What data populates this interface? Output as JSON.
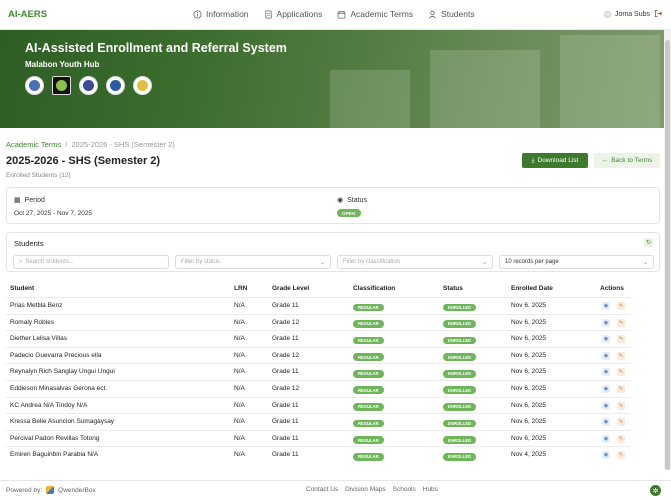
{
  "app": {
    "brand": "AI-AERS"
  },
  "nav": {
    "items": [
      {
        "label": "Information",
        "icon": "info-icon"
      },
      {
        "label": "Applications",
        "icon": "document-icon"
      },
      {
        "label": "Academic Terms",
        "icon": "calendar-icon"
      },
      {
        "label": "Students",
        "icon": "user-icon"
      }
    ],
    "user_name": "Joma Subs"
  },
  "hero": {
    "title": "AI-Assisted Enrollment and Referral System",
    "subtitle": "Malabon Youth Hub"
  },
  "breadcrumb": {
    "parent": "Academic Terms",
    "separator": "/",
    "current": "2025-2026 - SHS (Semester 2)"
  },
  "page": {
    "title": "2025-2026 - SHS (Semester 2)",
    "subtitle": "Enrolled Students (12)",
    "download_label": "Download List",
    "back_label": "Back to Terms"
  },
  "period": {
    "period_label": "Period",
    "period_value": "Oct 27, 2025 - Nov 7, 2025",
    "status_label": "Status",
    "status_value": "OPEN"
  },
  "students": {
    "title": "Students",
    "search_placeholder": "Search students...",
    "status_filter": "Filter by status",
    "classification_filter": "Filter by classification",
    "per_page": "10 records per page"
  },
  "table": {
    "columns": [
      "Student",
      "LRN",
      "Grade Level",
      "Classification",
      "Status",
      "Enrolled Date",
      "Actions"
    ],
    "rows": [
      {
        "student": "Prias Mettila Benz",
        "lrn": "N/A",
        "grade": "Grade 11",
        "classification": "REGULAR",
        "status": "ENROLLED",
        "date": "Nov 6, 2025"
      },
      {
        "student": "Romaly Robles",
        "lrn": "N/A",
        "grade": "Grade 12",
        "classification": "REGULAR",
        "status": "ENROLLED",
        "date": "Nov 6, 2025"
      },
      {
        "student": "Diether Lelisa Villas",
        "lrn": "N/A",
        "grade": "Grade 11",
        "classification": "REGULAR",
        "status": "ENROLLED",
        "date": "Nov 6, 2025"
      },
      {
        "student": "Padecio Guevarra Precious ella",
        "lrn": "N/A",
        "grade": "Grade 12",
        "classification": "REGULAR",
        "status": "ENROLLED",
        "date": "Nov 6, 2025"
      },
      {
        "student": "Reynalyn Rich Sanglay Ungui Ungui",
        "lrn": "N/A",
        "grade": "Grade 11",
        "classification": "REGULAR",
        "status": "ENROLLED",
        "date": "Nov 6, 2025"
      },
      {
        "student": "Eddieson Minasalvas Gerona ect.",
        "lrn": "N/A",
        "grade": "Grade 12",
        "classification": "REGULAR",
        "status": "ENROLLED",
        "date": "Nov 6, 2025"
      },
      {
        "student": "KC Andrea N/A Tindoy N/A",
        "lrn": "N/A",
        "grade": "Grade 11",
        "classification": "REGULAR",
        "status": "ENROLLED",
        "date": "Nov 6, 2025"
      },
      {
        "student": "Kressa Belle Asuncion Sumagaysay",
        "lrn": "N/A",
        "grade": "Grade 11",
        "classification": "REGULAR",
        "status": "ENROLLED",
        "date": "Nov 6, 2025"
      },
      {
        "student": "Percival Padon Revillas Totong",
        "lrn": "N/A",
        "grade": "Grade 11",
        "classification": "REGULAR",
        "status": "ENROLLED",
        "date": "Nov 6, 2025"
      },
      {
        "student": "Emiren Baguinbin Parabia N/A",
        "lrn": "N/A",
        "grade": "Grade 11",
        "classification": "REGULAR",
        "status": "ENROLLED",
        "date": "Nov 4, 2025"
      }
    ]
  },
  "footer": {
    "powered_by": "Powered by:",
    "company": "QwenderBox",
    "links": [
      "Contact Us",
      "Division Maps",
      "Schools",
      "Hubs"
    ]
  },
  "colors": {
    "brand_green": "#3f8a2f",
    "badge_green": "#6fb55a",
    "button_green": "#3d7a2e"
  }
}
